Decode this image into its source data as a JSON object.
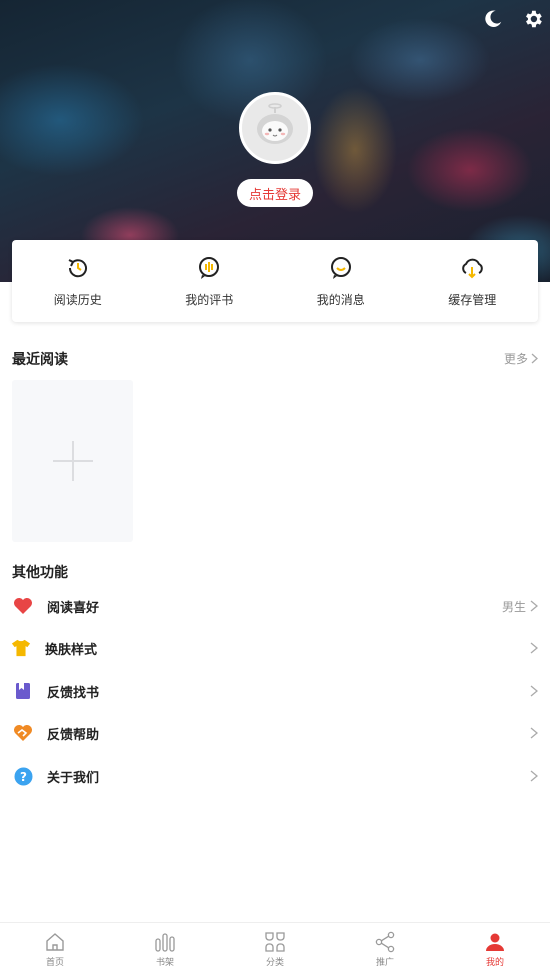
{
  "header": {
    "login_label": "点击登录",
    "icons": [
      "moon-icon",
      "gear-icon"
    ]
  },
  "quick_actions": [
    {
      "label": "阅读历史",
      "icon": "history-icon"
    },
    {
      "label": "我的评书",
      "icon": "review-icon"
    },
    {
      "label": "我的消息",
      "icon": "message-icon"
    },
    {
      "label": "缓存管理",
      "icon": "cloud-download-icon"
    }
  ],
  "recent": {
    "title": "最近阅读",
    "more_label": "更多"
  },
  "other": {
    "title": "其他功能",
    "items": [
      {
        "label": "阅读喜好",
        "value": "男生",
        "icon": "heart-icon",
        "color": "#e84545"
      },
      {
        "label": "换肤样式",
        "value": "",
        "icon": "shirt-icon",
        "color": "#f5b800"
      },
      {
        "label": "反馈找书",
        "value": "",
        "icon": "book-icon",
        "color": "#6a5acd"
      },
      {
        "label": "反馈帮助",
        "value": "",
        "icon": "handshake-icon",
        "color": "#f08a24"
      },
      {
        "label": "关于我们",
        "value": "",
        "icon": "question-icon",
        "color": "#3ba3f0"
      }
    ]
  },
  "tabbar": [
    {
      "label": "首页",
      "icon": "home-icon",
      "active": false
    },
    {
      "label": "书架",
      "icon": "bookshelf-icon",
      "active": false
    },
    {
      "label": "分类",
      "icon": "category-icon",
      "active": false
    },
    {
      "label": "推广",
      "icon": "share-icon",
      "active": false
    },
    {
      "label": "我的",
      "icon": "user-icon",
      "active": true
    }
  ],
  "colors": {
    "accent": "#e53935",
    "text": "#222222",
    "muted": "#999999"
  }
}
